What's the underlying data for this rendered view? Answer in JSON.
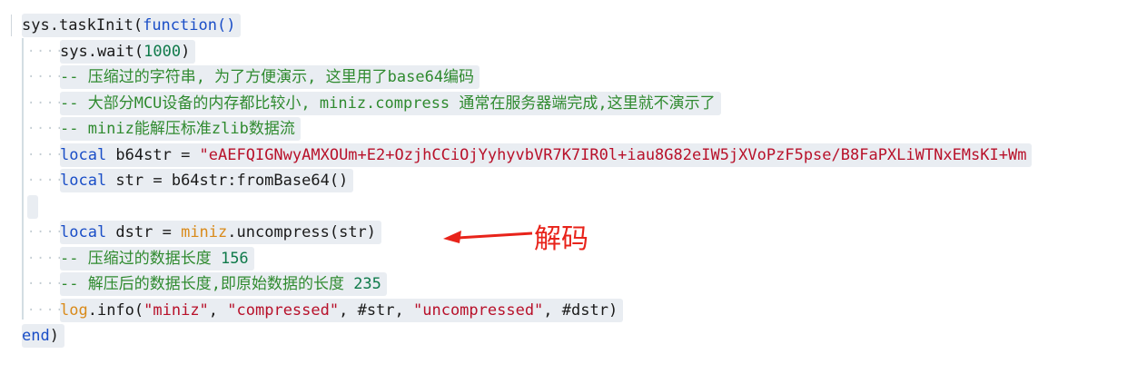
{
  "code": {
    "line1": {
      "a": "sys",
      "b": ".taskInit(",
      "c": "function",
      "d": "()"
    },
    "line2": {
      "a": "sys.wait(",
      "b": "1000",
      "c": ")"
    },
    "line3": {
      "a": "-- 压缩过的字符串, 为了方便演示, 这里用了base64编码"
    },
    "line4": {
      "a": "-- 大部分MCU设备的内存都比较小, miniz.compress 通常在服务器端完成,这里就不演示了"
    },
    "line5": {
      "a": "-- miniz能解压标准zlib数据流"
    },
    "line6": {
      "kw": "local",
      "a": " b64str = ",
      "s": "\"eAEFQIGNwyAMXOUm+E2+OzjhCCiOjYyhyvbVR7K7IR0l+iau8G82eIW5jXVoPzF5pse/B8FaPXLiWTNxEMsKI+Wm"
    },
    "line7": {
      "kw": "local",
      "a": " str = b64str:fromBase64()"
    },
    "line8": {},
    "line9": {
      "kw": "local",
      "a": " dstr = ",
      "lib": "miniz",
      "b": ".uncompress(str)"
    },
    "line10": {
      "a": "-- 压缩过的数据长度 ",
      "n": "156"
    },
    "line11": {
      "a": "-- 解压后的数据长度,即原始数据的长度 ",
      "n": "235"
    },
    "line12": {
      "lib": "log",
      "a": ".info(",
      "s1": "\"miniz\"",
      "c1": ", ",
      "s2": "\"compressed\"",
      "c2": ", #str, ",
      "s3": "\"uncompressed\"",
      "c3": ", #dstr)"
    },
    "line13": {
      "kw": "end",
      "a": ")"
    }
  },
  "indent_dots": "····",
  "annotation": {
    "label": "解码",
    "color": "#e8231a"
  },
  "colors": {
    "keyword": "#1a4ec7",
    "comment": "#2f8a2f",
    "string": "#b8112a",
    "number": "#0f7a4a",
    "library": "#d98a1a",
    "line_highlight": "#e9edf2"
  }
}
